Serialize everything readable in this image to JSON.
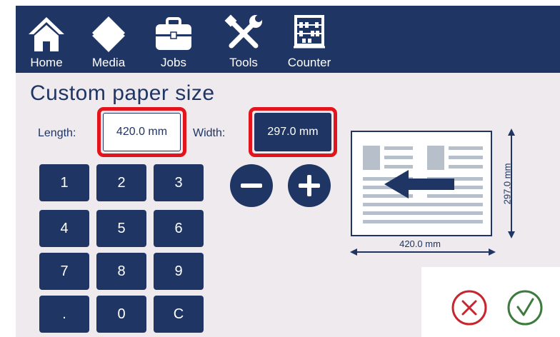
{
  "nav": {
    "items": [
      {
        "label": "Home",
        "icon": "home-icon"
      },
      {
        "label": "Media",
        "icon": "media-icon"
      },
      {
        "label": "Jobs",
        "icon": "briefcase-icon"
      },
      {
        "label": "Tools",
        "icon": "tools-icon"
      },
      {
        "label": "Counter",
        "icon": "abacus-icon"
      }
    ]
  },
  "page": {
    "title": "Custom paper size"
  },
  "length": {
    "label": "Length:",
    "value": "420.0 mm"
  },
  "width": {
    "label": "Width:",
    "value": "297.0 mm"
  },
  "keypad": {
    "keys": [
      "1",
      "2",
      "3",
      "4",
      "5",
      "6",
      "7",
      "8",
      "9",
      ".",
      "0",
      "C"
    ]
  },
  "adjust": {
    "decrease_icon": "minus-icon",
    "increase_icon": "plus-icon"
  },
  "diagram": {
    "height_label": "297.0 mm",
    "width_label": "420.0 mm"
  },
  "actions": {
    "cancel_icon": "cancel-icon",
    "confirm_icon": "confirm-icon"
  },
  "colors": {
    "navy": "#1f3563",
    "highlight": "#e3141b",
    "cancel": "#c8262e",
    "confirm": "#3e7a3e",
    "panel": "#efeaee"
  }
}
